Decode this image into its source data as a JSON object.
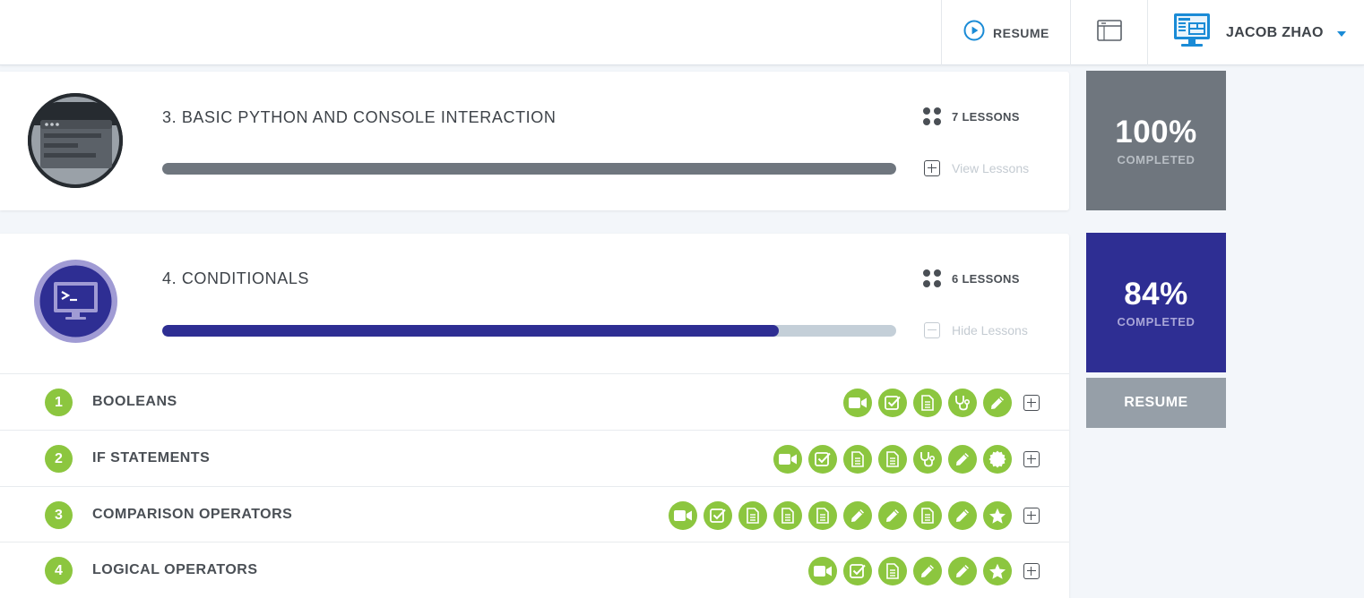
{
  "header": {
    "resume_label": "RESUME",
    "user_name": "JACOB ZHAO"
  },
  "courses": [
    {
      "title": "3. BASIC PYTHON AND CONSOLE INTERACTION",
      "lessons_count": "7 LESSONS",
      "toggle_label": "View Lessons",
      "progress_fraction": 1.0,
      "percent": "100%",
      "completed_label": "COMPLETED",
      "color": "#6f767e",
      "progress_color": "#6f767e"
    },
    {
      "title": "4. CONDITIONALS",
      "lessons_count": "6 LESSONS",
      "toggle_label": "Hide Lessons",
      "progress_fraction": 0.84,
      "percent": "84%",
      "completed_label": "COMPLETED",
      "color": "#2e2e93",
      "progress_color": "#2e2e93",
      "resume_label": "RESUME",
      "lessons": [
        {
          "number": "1",
          "name": "BOOLEANS",
          "activities": [
            "video",
            "quiz",
            "document",
            "stethoscope",
            "pencil"
          ]
        },
        {
          "number": "2",
          "name": "IF STATEMENTS",
          "activities": [
            "video",
            "quiz",
            "document",
            "document",
            "stethoscope",
            "pencil",
            "badge"
          ]
        },
        {
          "number": "3",
          "name": "COMPARISON OPERATORS",
          "activities": [
            "video",
            "quiz",
            "document",
            "document",
            "document",
            "pencil",
            "pencil",
            "document",
            "pencil",
            "star"
          ]
        },
        {
          "number": "4",
          "name": "LOGICAL OPERATORS",
          "activities": [
            "video",
            "quiz",
            "document",
            "pencil",
            "pencil",
            "star"
          ]
        }
      ]
    }
  ],
  "colors": {
    "accent_green": "#8cc63f",
    "resume_blue": "#1a8bd6",
    "progress_track": "#c4cfd8",
    "side_resume": "#969fa8"
  }
}
